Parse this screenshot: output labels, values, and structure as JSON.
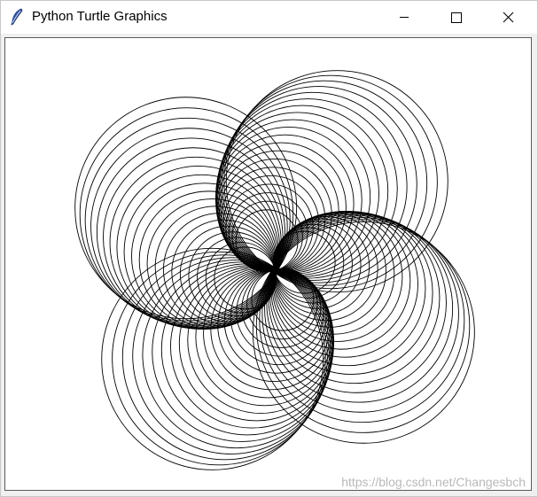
{
  "window": {
    "title": "Python Turtle Graphics",
    "app_icon": "feather-icon",
    "controls": {
      "minimize_icon": "minimize-icon",
      "maximize_icon": "maximize-icon",
      "close_icon": "close-icon"
    }
  },
  "drawing": {
    "stroke_color": "#000000",
    "background_color": "#ffffff",
    "description_free_pattern": {
      "lobes": 4,
      "circles_per_lobe": 20
    }
  },
  "watermark": {
    "text": "https://blog.csdn.net/Changesbch"
  }
}
